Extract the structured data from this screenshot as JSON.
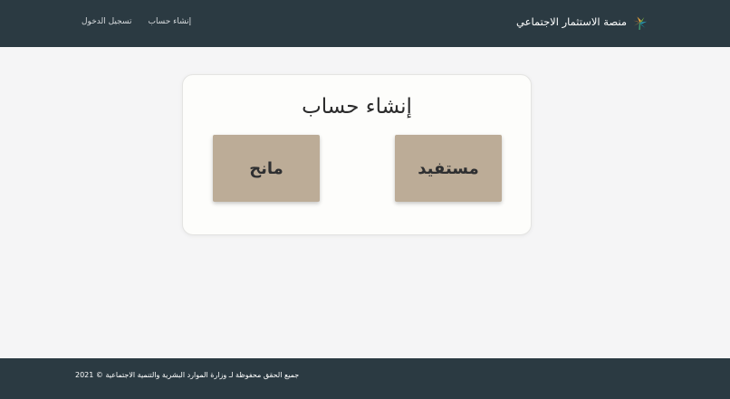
{
  "header": {
    "brand_name": "منصة الاستثمار الاجتماعي",
    "nav": {
      "create_account": "إنشاء حساب",
      "login": "تسجيل الدخول"
    }
  },
  "main": {
    "title": "إنشاء حساب",
    "options": {
      "beneficiary": "مستفيد",
      "donor": "مانح"
    }
  },
  "footer": {
    "copyright": "جميع الحقق محفوظة لـ وزارة الموارد البشرية والتنمية الاجتماعية © 2021"
  },
  "colors": {
    "header_bg": "#2b3a42",
    "card_button_bg": "#bcac97",
    "page_bg": "#f5f5f6"
  }
}
